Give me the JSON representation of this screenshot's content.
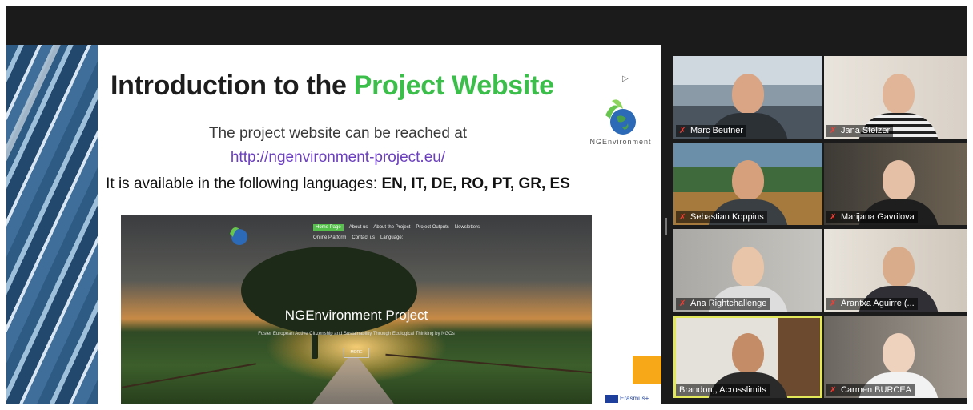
{
  "slide": {
    "title_prefix": "Introduction to the ",
    "title_highlight": "Project Website",
    "line1": "The project website can be reached at",
    "url": "http://ngenvironment-project.eu/",
    "languages_prefix": "It  is available in the following languages: ",
    "languages": "EN, IT, DE, RO, PT, GR, ES",
    "logo_text": "NGEnvironment",
    "erasmus": "Erasmus+"
  },
  "website": {
    "nav": [
      "Home Page",
      "About us",
      "About the Project",
      "Project Outputs",
      "Newsletters",
      "Online Platform",
      "Contact us",
      "Language:"
    ],
    "title": "NGEnvironment Project",
    "subtitle": "Foster European Active Citizenship and Sustainability Through Ecological Thinking by NGOs",
    "more": "MORE"
  },
  "participants": [
    {
      "name": "Marc Beutner",
      "muted": true
    },
    {
      "name": "Jana Stelzer",
      "muted": true
    },
    {
      "name": "Sebastian Koppius",
      "muted": true
    },
    {
      "name": "Marijana Gavrilova",
      "muted": true
    },
    {
      "name": "Ana Rightchallenge",
      "muted": true
    },
    {
      "name": "Arantxa Aguirre (...",
      "muted": true
    },
    {
      "name": "Brandon,, Acrosslimits",
      "muted": false,
      "active_speaker": true
    },
    {
      "name": "Carmen BURCEA",
      "muted": true
    }
  ],
  "icons": {
    "muted": "mic-off-icon"
  },
  "colors": {
    "title_highlight": "#3bbf4a",
    "active_speaker_border": "#e3e85a",
    "muted_icon": "#ff3b30"
  }
}
